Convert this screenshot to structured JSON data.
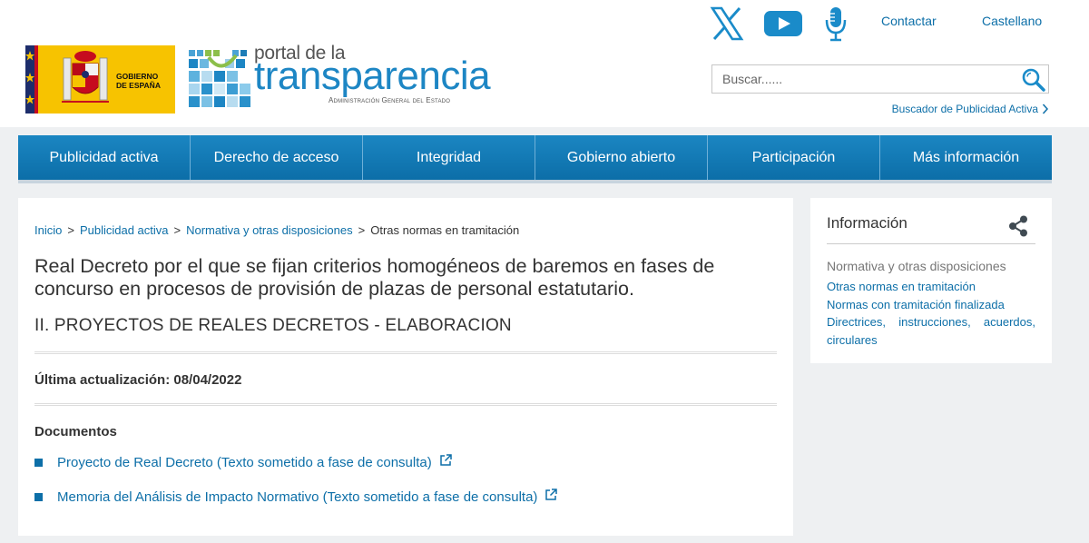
{
  "header": {
    "social": [
      {
        "icon": "x-twitter-icon"
      },
      {
        "icon": "youtube-icon"
      },
      {
        "icon": "podcast-microphone-icon"
      }
    ],
    "contact_label": "Contactar",
    "language_label": "Castellano",
    "gov_logo_text": [
      "GOBIERNO",
      "DE ESPAÑA"
    ],
    "portal_logo": {
      "line1": "portal de la",
      "line2": "transparencia",
      "line3": "Administración General del Estado"
    },
    "search": {
      "placeholder": "Buscar......"
    },
    "buscador_link": "Buscador de Publicidad Activa"
  },
  "nav": {
    "items": [
      {
        "label": "Publicidad activa"
      },
      {
        "label": "Derecho de acceso"
      },
      {
        "label": "Integridad"
      },
      {
        "label": "Gobierno abierto"
      },
      {
        "label": "Participación"
      },
      {
        "label": "Más información"
      }
    ]
  },
  "breadcrumb": {
    "items": [
      "Inicio",
      "Publicidad activa",
      "Normativa y otras disposiciones"
    ],
    "current": "Otras normas en tramitación",
    "separator": ">"
  },
  "main": {
    "title": "Real Decreto por el que se fijan criterios homogéneos de baremos en fases de concurso en procesos de provisión de plazas de personal estatutario.",
    "subtitle": "II. PROYECTOS DE REALES DECRETOS - ELABORACION",
    "updated": "Última actualización: 08/04/2022",
    "documents_heading": "Documentos",
    "documents": [
      {
        "label": "Proyecto de Real Decreto (Texto sometido a fase de consulta)"
      },
      {
        "label": "Memoria del Análisis de Impacto Normativo (Texto sometido a fase de consulta)"
      }
    ]
  },
  "side": {
    "title": "Información",
    "section_label": "Normativa y otras disposiciones",
    "links": [
      {
        "label": "Otras normas en tramitación"
      },
      {
        "label": "Normas con tramitación finalizada"
      },
      {
        "label": "Directrices, instrucciones, acuerdos, circulares"
      }
    ]
  },
  "colors": {
    "accent": "#0d6fa8",
    "nav": "#1b86c2",
    "background": "#eef0f2"
  }
}
